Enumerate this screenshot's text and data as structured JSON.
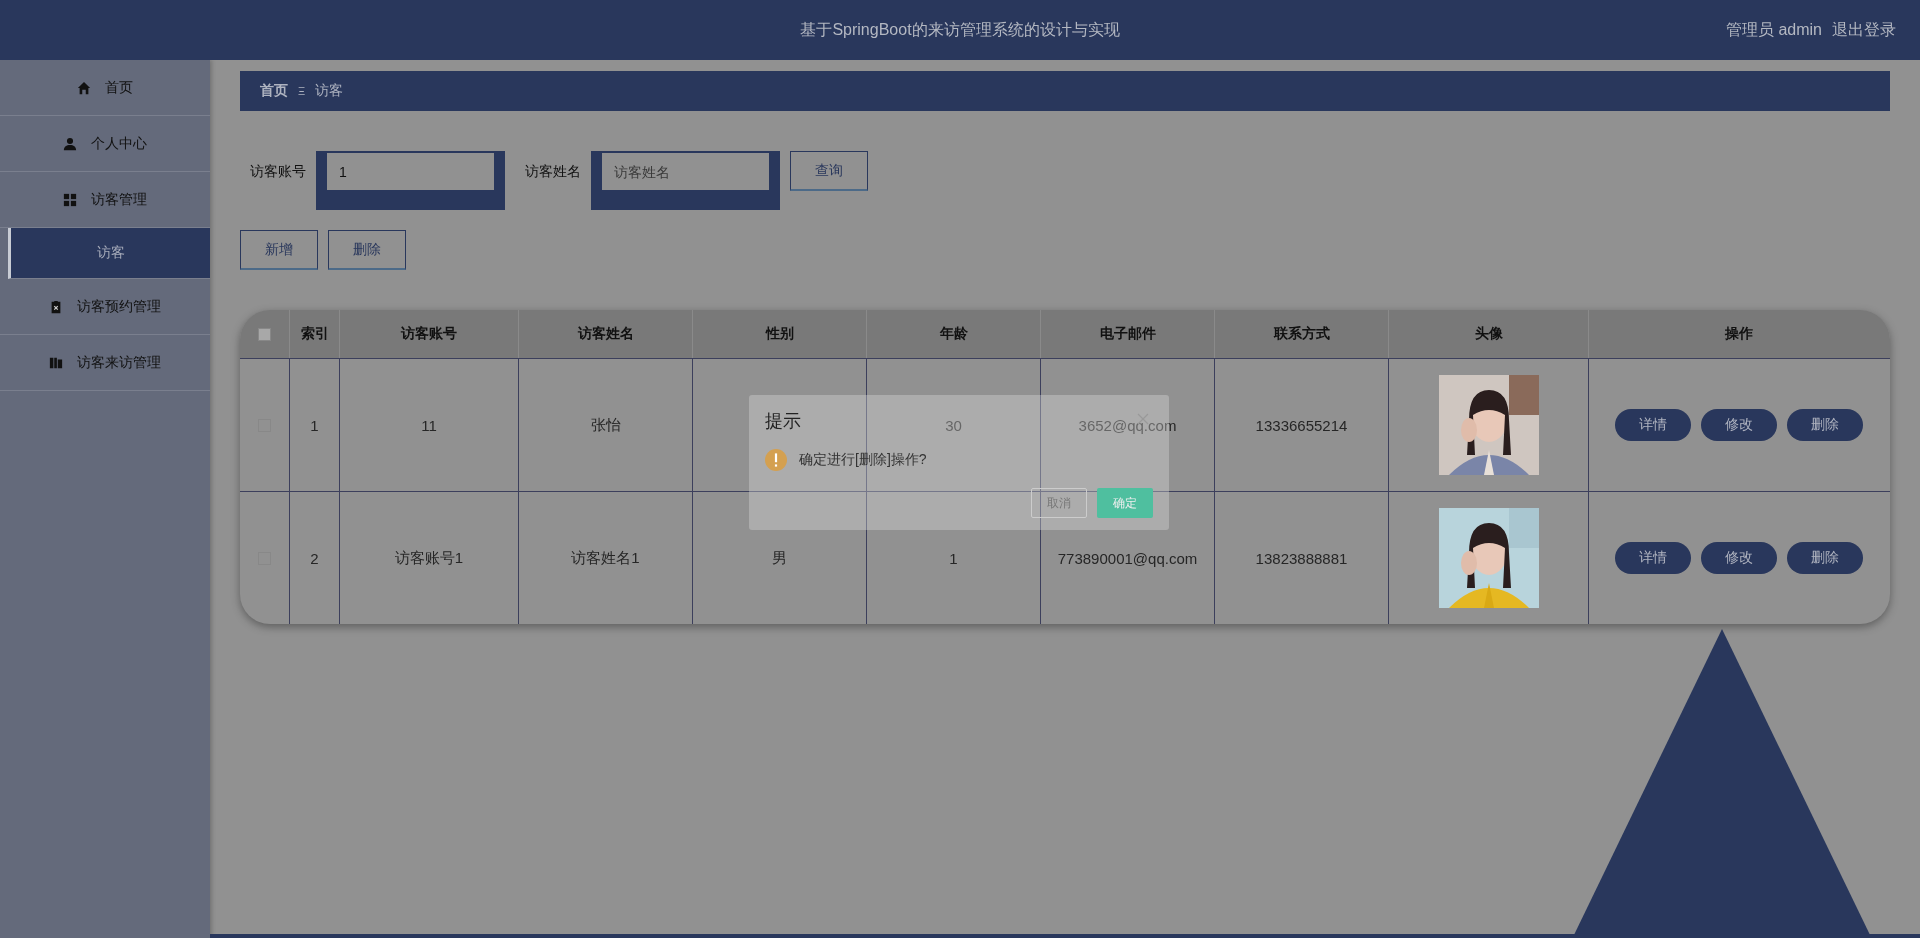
{
  "header": {
    "title": "基于SpringBoot的来访管理系统的设计与实现",
    "user": "管理员 admin",
    "logout": "退出登录"
  },
  "sidebar": {
    "items": [
      {
        "label": "首页",
        "selected": false
      },
      {
        "label": "个人中心",
        "selected": false
      },
      {
        "label": "访客管理",
        "selected": false,
        "children": [
          {
            "label": "访客",
            "selected": true
          }
        ]
      },
      {
        "label": "访客预约管理",
        "selected": false
      },
      {
        "label": "访客来访管理",
        "selected": false
      }
    ]
  },
  "breadcrumb": {
    "items": [
      "首页",
      "访客"
    ],
    "separator": "Ξ"
  },
  "search": {
    "fields": [
      {
        "label": "访客账号",
        "value": "1"
      },
      {
        "label": "访客姓名",
        "placeholder": "访客姓名"
      }
    ],
    "button": "查询"
  },
  "actions": [
    "新增",
    "删除"
  ],
  "table": {
    "header_checked": false,
    "columns": [
      "索引",
      "访客账号",
      "访客姓名",
      "性别",
      "年龄",
      "电子邮件",
      "联系方式",
      "头像",
      "操作"
    ],
    "rows": [
      {
        "checked": false,
        "cells": [
          "1",
          "11",
          "张怡",
          "",
          "30",
          "3652@qq.com",
          "13336655214"
        ],
        "buttons": [
          "详情",
          "修改",
          "删除"
        ]
      },
      {
        "checked": false,
        "cells": [
          "2",
          "访客账号1",
          "访客姓名1",
          "男",
          "1",
          "773890001@qq.com",
          "13823888881"
        ],
        "buttons": [
          "详情",
          "修改",
          "删除"
        ]
      }
    ]
  },
  "dialog": {
    "title": "提示",
    "message": "确定进行[删除]操作?",
    "cancel": "取消",
    "confirm": "确定"
  }
}
